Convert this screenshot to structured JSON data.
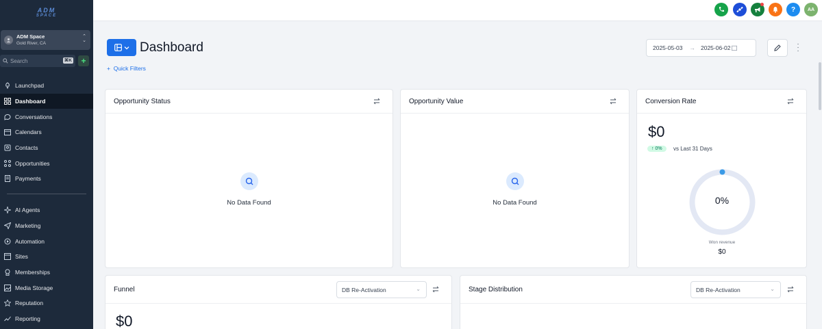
{
  "app": {
    "logo_text": "ADM",
    "logo_sub": "SPACE"
  },
  "account": {
    "name": "ADM Space",
    "location": "Gold River, CA"
  },
  "search": {
    "placeholder": "Search",
    "shortcut": "⌘K",
    "add_label": "+"
  },
  "sidebar": {
    "items": [
      {
        "label": "Launchpad",
        "icon": "rocket-icon"
      },
      {
        "label": "Dashboard",
        "icon": "grid-icon",
        "active": true
      },
      {
        "label": "Conversations",
        "icon": "chat-icon"
      },
      {
        "label": "Calendars",
        "icon": "calendar-icon"
      },
      {
        "label": "Contacts",
        "icon": "contacts-icon"
      },
      {
        "label": "Opportunities",
        "icon": "opportunities-icon"
      },
      {
        "label": "Payments",
        "icon": "payments-icon"
      }
    ],
    "items2": [
      {
        "label": "AI Agents",
        "icon": "sparkle-icon"
      },
      {
        "label": "Marketing",
        "icon": "send-icon"
      },
      {
        "label": "Automation",
        "icon": "automation-icon"
      },
      {
        "label": "Sites",
        "icon": "sites-icon"
      },
      {
        "label": "Memberships",
        "icon": "membership-icon"
      },
      {
        "label": "Media Storage",
        "icon": "media-icon"
      },
      {
        "label": "Reputation",
        "icon": "star-icon"
      },
      {
        "label": "Reporting",
        "icon": "chart-icon"
      }
    ]
  },
  "topbar": {
    "icons": [
      {
        "name": "phone-icon",
        "color": "#16a34a"
      },
      {
        "name": "satellite-icon",
        "color": "#1d4ed8"
      },
      {
        "name": "megaphone-icon",
        "color": "#15803d"
      },
      {
        "name": "bell-icon",
        "color": "#f97316"
      },
      {
        "name": "help-icon",
        "color": "#1d8cf0"
      }
    ],
    "avatar_initials": "AA",
    "help_glyph": "?"
  },
  "header": {
    "title": "Dashboard",
    "quick_filters": "Quick Filters",
    "date_start": "2025-05-03",
    "date_end": "2025-06-02"
  },
  "cards": {
    "opportunity_status": {
      "title": "Opportunity Status",
      "empty": "No Data Found"
    },
    "opportunity_value": {
      "title": "Opportunity Value",
      "empty": "No Data Found"
    },
    "conversion_rate": {
      "title": "Conversion Rate",
      "value": "$0",
      "change": "0%",
      "change_label": "vs Last 31 Days",
      "donut_pct": "0%",
      "won_label": "Won revenue",
      "won_value": "$0"
    },
    "funnel": {
      "title": "Funnel",
      "select": "DB Re-Activation",
      "value": "$0"
    },
    "stage_distribution": {
      "title": "Stage Distribution",
      "select": "DB Re-Activation"
    }
  },
  "colors": {
    "primary": "#1d6fe8",
    "sidebar": "#1d2a3b",
    "success": "#047857"
  }
}
